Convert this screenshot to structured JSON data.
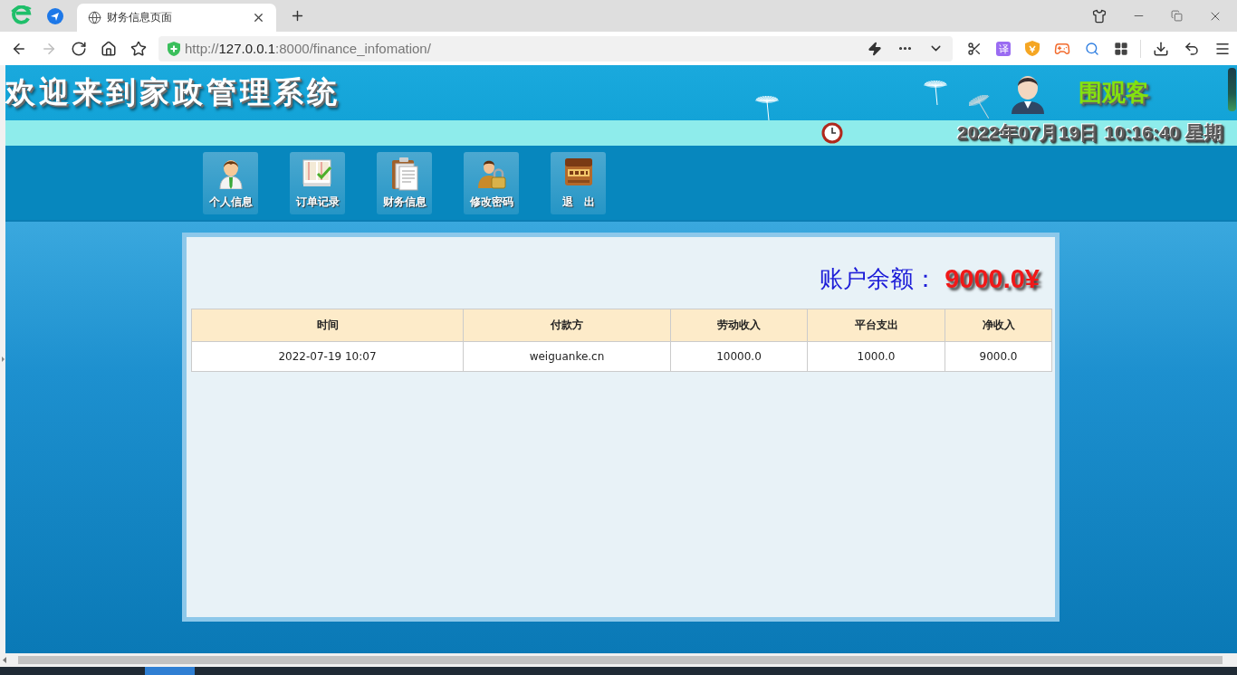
{
  "browser": {
    "tabs": [
      {
        "title": "财务信息页面",
        "selected": true
      }
    ],
    "toolbar": [
      {
        "kind": "back",
        "disabled": false
      },
      {
        "kind": "forward",
        "disabled": true
      },
      {
        "kind": "reload",
        "disabled": false
      },
      {
        "kind": "home",
        "disabled": false
      },
      {
        "kind": "bookmarks",
        "disabled": false
      }
    ],
    "address": {
      "scheme": "http://",
      "host": "127.0.0.1",
      "path": ":8000/finance_infomation/"
    },
    "extensions": [
      {
        "kind": "cut"
      },
      {
        "kind": "translate",
        "label": "译"
      },
      {
        "kind": "shield"
      },
      {
        "kind": "game"
      },
      {
        "kind": "search"
      },
      {
        "kind": "apps"
      },
      {
        "kind": "download"
      },
      {
        "kind": "undo"
      },
      {
        "kind": "menu"
      }
    ]
  },
  "header": {
    "title": "欢迎来到家政管理系统",
    "user": "围观客",
    "datetime": "2022年07月19日 10:16:40 星期"
  },
  "nav_buttons": [
    {
      "label": "个人信息",
      "kind": "person"
    },
    {
      "label": "订单记录",
      "kind": "orders"
    },
    {
      "label": "财务信息",
      "kind": "finance"
    },
    {
      "label": "修改密码",
      "kind": "password"
    },
    {
      "label": "退　出",
      "kind": "exit"
    }
  ],
  "balance": {
    "label": "账户余额：",
    "amount": "9000.0¥"
  },
  "table": {
    "columns": [
      "时间",
      "付款方",
      "劳动收入",
      "平台支出",
      "净收入"
    ],
    "rows": [
      [
        "2022-07-19 10:07",
        "weiguanke.cn",
        "10000.0",
        "1000.0",
        "9000.0"
      ]
    ]
  }
}
